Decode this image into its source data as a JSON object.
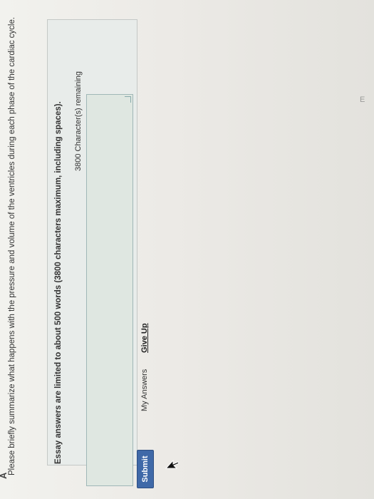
{
  "part_label": "A",
  "question": "Please briefly summarize what happens with the pressure and volume of the ventricles during each phase of the cardiac cycle.",
  "essay": {
    "limit_text": "Essay answers are limited to about 500 words (3800 characters maximum, including spaces).",
    "remaining_text": "3800 Character(s) remaining",
    "value": ""
  },
  "actions": {
    "submit_label": "Submit",
    "my_answers_label": "My Answers",
    "give_up_label": "Give Up"
  },
  "edge_text": "E",
  "colors": {
    "submit_bg": "#3f69a8",
    "textarea_bg": "#dfe7e1",
    "panel_bg": "#e8ecea"
  },
  "icons": [
    "mouse-pointer-icon",
    "resize-handle-icon"
  ]
}
